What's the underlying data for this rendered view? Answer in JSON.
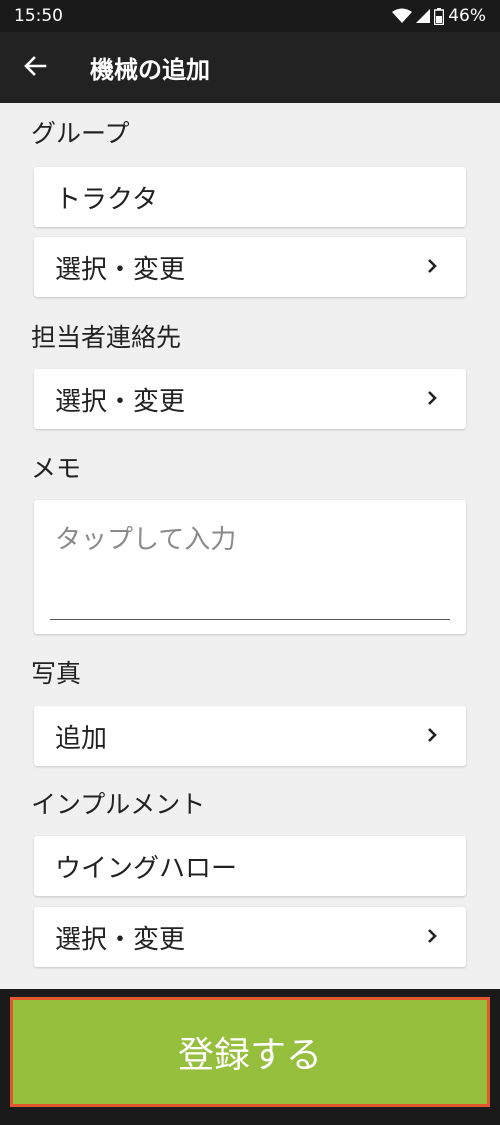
{
  "status_bar": {
    "time": "15:50",
    "battery": "46%",
    "icons": [
      "wifi-icon",
      "signal-icon",
      "battery-icon"
    ]
  },
  "app_bar": {
    "title": "機械の追加",
    "back_icon": "back-arrow-icon"
  },
  "sections": {
    "group": {
      "label": "グループ",
      "value": "トラクタ",
      "action": "選択・変更"
    },
    "contact": {
      "label": "担当者連絡先",
      "action": "選択・変更"
    },
    "memo": {
      "label": "メモ",
      "placeholder": "タップして入力"
    },
    "photo": {
      "label": "写真",
      "action": "追加"
    },
    "implement": {
      "label": "インプルメント",
      "value": "ウイングハロー",
      "action": "選択・変更"
    }
  },
  "footer": {
    "register_label": "登録する"
  },
  "colors": {
    "accent_green": "#95bf3c",
    "highlight_border": "#e3572d",
    "app_bar": "#222222",
    "background": "#f0f0f0"
  }
}
